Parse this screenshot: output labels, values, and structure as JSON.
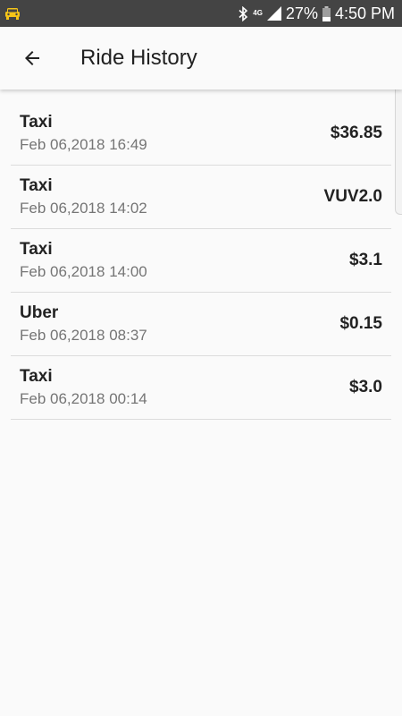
{
  "status_bar": {
    "network": "4G",
    "battery": "27%",
    "time": "4:50 PM",
    "icons": [
      "taxi-icon",
      "bluetooth-icon",
      "signal-icon",
      "battery-icon"
    ]
  },
  "header": {
    "title": "Ride History",
    "back_icon": "arrow-left-icon"
  },
  "rides": [
    {
      "service": "Taxi",
      "date": "Feb 06,2018 16:49",
      "fare": "$36.85"
    },
    {
      "service": "Taxi",
      "date": "Feb 06,2018 14:02",
      "fare": "VUV2.0"
    },
    {
      "service": "Taxi",
      "date": "Feb 06,2018 14:00",
      "fare": "$3.1"
    },
    {
      "service": "Uber",
      "date": "Feb 06,2018 08:37",
      "fare": "$0.15"
    },
    {
      "service": "Taxi",
      "date": "Feb 06,2018 00:14",
      "fare": "$3.0"
    }
  ],
  "colors": {
    "status_bar_bg": "#444444",
    "background": "#fafafa",
    "taxi_icon": "#f5c518",
    "divider": "#dcdcdc"
  }
}
